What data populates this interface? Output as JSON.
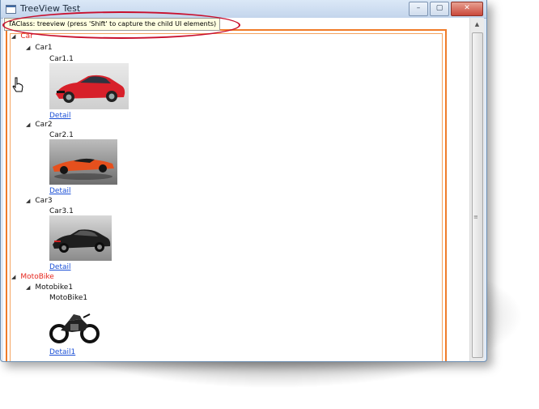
{
  "window": {
    "title": "TreeView Test",
    "buttons": {
      "minimize": "–",
      "maximize": "▢",
      "close": "✕"
    }
  },
  "tip": "TAClass: treeview (press 'Shift' to capture the child UI elements)",
  "tree": {
    "car": {
      "label": "Car",
      "items": [
        {
          "label": "Car1",
          "child": "Car1.1",
          "link": "Detail"
        },
        {
          "label": "Car2",
          "child": "Car2.1",
          "link": "Detail"
        },
        {
          "label": "Car3",
          "child": "Car3.1",
          "link": "Detail"
        }
      ]
    },
    "motobike": {
      "label": "MotoBike",
      "items": [
        {
          "label": "Motobike1",
          "child": "MotoBike1",
          "link": "Detail1"
        }
      ]
    }
  },
  "colors": {
    "category": "#e5261d",
    "link": "#1a4fd6",
    "frame": "#f07c2a"
  },
  "icons": {
    "expanded": "◢",
    "cursor": "hand-pointer-icon",
    "grip": "≡"
  }
}
